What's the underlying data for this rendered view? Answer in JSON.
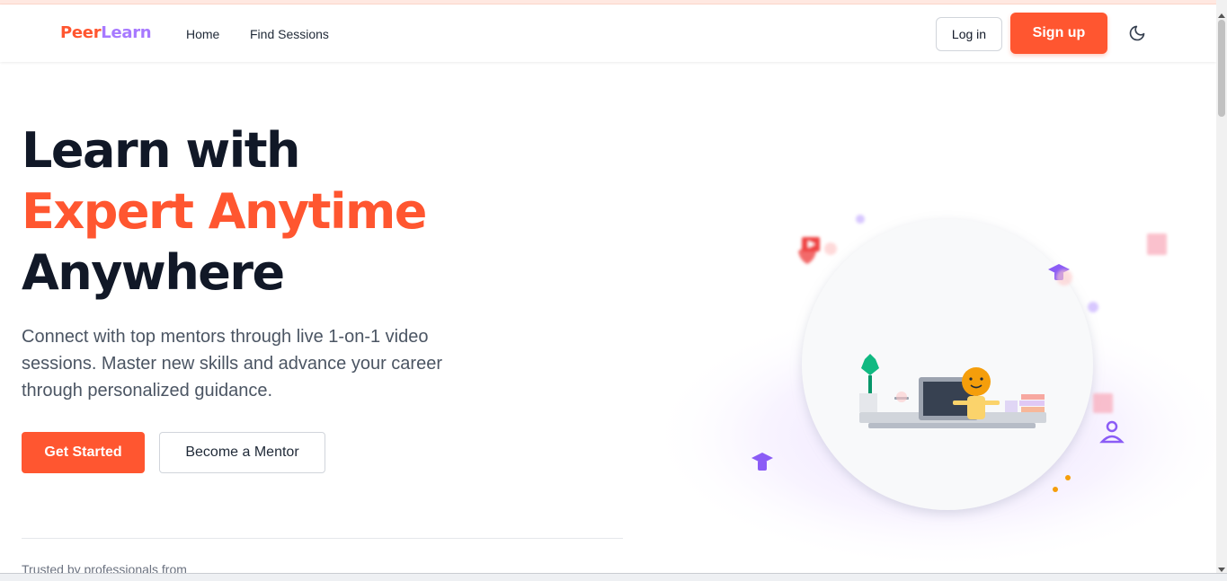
{
  "brand": {
    "part1": "Peer",
    "part2": "Learn"
  },
  "nav": {
    "home": "Home",
    "find_sessions": "Find Sessions"
  },
  "auth": {
    "login": "Log in",
    "signup": "Sign up"
  },
  "hero": {
    "line1": "Learn with",
    "line2": "Expert Anytime",
    "line3": "Anywhere",
    "description": "Connect with top mentors through live 1-on-1 video sessions. Master new skills and advance your career through personalized guidance.",
    "cta_primary": "Get Started",
    "cta_secondary": "Become a Mentor"
  },
  "trusted": "Trusted by professionals from",
  "colors": {
    "accent": "#ff5630",
    "brand_secondary": "#a779ff",
    "heading": "#111827",
    "body": "#4b5563"
  },
  "icons": {
    "theme_toggle": "moon-icon",
    "floating": [
      "video-pin-icon",
      "graduation-cap-icon",
      "user-icon",
      "book-icon"
    ]
  }
}
